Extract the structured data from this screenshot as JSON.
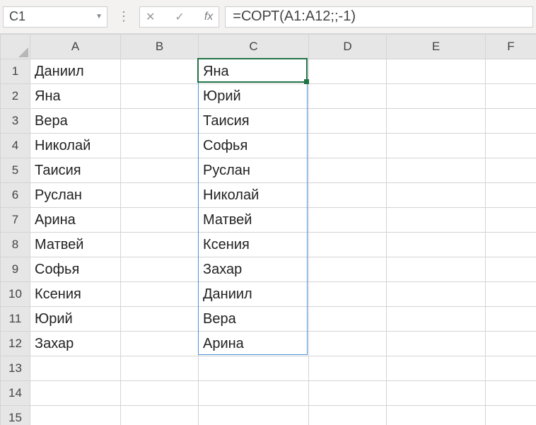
{
  "formula_bar": {
    "cell_ref": "C1",
    "formula": "=СОРТ(A1:A12;;-1)",
    "fx_label": "fx"
  },
  "columns": [
    "A",
    "B",
    "C",
    "D",
    "E",
    "F"
  ],
  "rows": [
    "1",
    "2",
    "3",
    "4",
    "5",
    "6",
    "7",
    "8",
    "9",
    "10",
    "11",
    "12",
    "13",
    "14",
    "15"
  ],
  "data_a": [
    "Даниил",
    "Яна",
    "Вера",
    "Николай",
    "Таисия",
    "Руслан",
    "Арина",
    "Матвей",
    "Софья",
    "Ксения",
    "Юрий",
    "Захар"
  ],
  "data_c": [
    "Яна",
    "Юрий",
    "Таисия",
    "Софья",
    "Руслан",
    "Николай",
    "Матвей",
    "Ксения",
    "Захар",
    "Даниил",
    "Вера",
    "Арина"
  ],
  "active": {
    "col": "C",
    "row": 1
  },
  "spill": {
    "col": "C",
    "from": 1,
    "to": 12
  }
}
